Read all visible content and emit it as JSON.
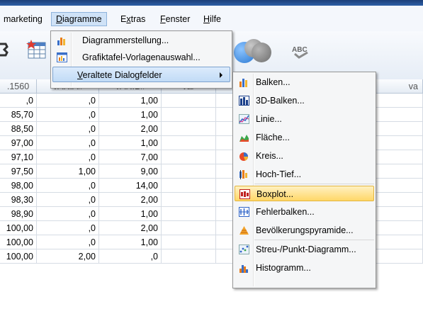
{
  "menubar": {
    "items": [
      {
        "label": "marketing",
        "accel": ""
      },
      {
        "label": "Diagramme",
        "accel": "D"
      },
      {
        "label": "Extras",
        "accel": "x"
      },
      {
        "label": "Fenster",
        "accel": "F"
      },
      {
        "label": "Hilfe",
        "accel": "H"
      }
    ]
  },
  "toolbar": {
    "abc_label": "ABC"
  },
  "grid": {
    "headers": [
      ".1560",
      "VAR.A#",
      "VAR.B#",
      "var"
    ],
    "rows": [
      [
        ",0",
        ",0",
        "1,00"
      ],
      [
        "85,70",
        ",0",
        "1,00"
      ],
      [
        "88,50",
        ",0",
        "2,00"
      ],
      [
        "97,00",
        ",0",
        "1,00"
      ],
      [
        "97,10",
        ",0",
        "7,00"
      ],
      [
        "97,50",
        "1,00",
        "9,00"
      ],
      [
        "98,00",
        ",0",
        "14,00"
      ],
      [
        "98,30",
        ",0",
        "2,00"
      ],
      [
        "98,90",
        ",0",
        "1,00"
      ],
      [
        "100,00",
        ",0",
        "2,00"
      ],
      [
        "100,00",
        ",0",
        "1,00"
      ],
      [
        "100,00",
        "2,00",
        ",0"
      ]
    ],
    "right_header": "va"
  },
  "diagramme_menu": {
    "items": [
      {
        "label": "Diagrammerstellung...",
        "icon": "chart-builder-icon"
      },
      {
        "label": "Grafiktafel-Vorlagenauswahl...",
        "icon": "template-chooser-icon"
      },
      {
        "label": "Veraltete Dialogfelder",
        "icon": "",
        "submenu": true
      }
    ]
  },
  "legacy_submenu": {
    "items": [
      {
        "label": "Balken...",
        "icon": "bar-chart-icon"
      },
      {
        "label": "3D-Balken...",
        "icon": "3d-bar-chart-icon"
      },
      {
        "label": "Linie...",
        "icon": "line-chart-icon"
      },
      {
        "label": "Fläche...",
        "icon": "area-chart-icon"
      },
      {
        "label": "Kreis...",
        "icon": "pie-chart-icon"
      },
      {
        "label": "Hoch-Tief...",
        "icon": "high-low-chart-icon"
      },
      {
        "label": "Boxplot...",
        "icon": "boxplot-icon",
        "highlighted": true
      },
      {
        "label": "Fehlerbalken...",
        "icon": "error-bar-icon"
      },
      {
        "label": "Bevölkerungspyramide...",
        "icon": "population-pyramid-icon"
      },
      {
        "label": "Streu-/Punkt-Diagramm...",
        "icon": "scatter-plot-icon"
      },
      {
        "label": "Histogramm...",
        "icon": "histogram-icon"
      }
    ]
  }
}
